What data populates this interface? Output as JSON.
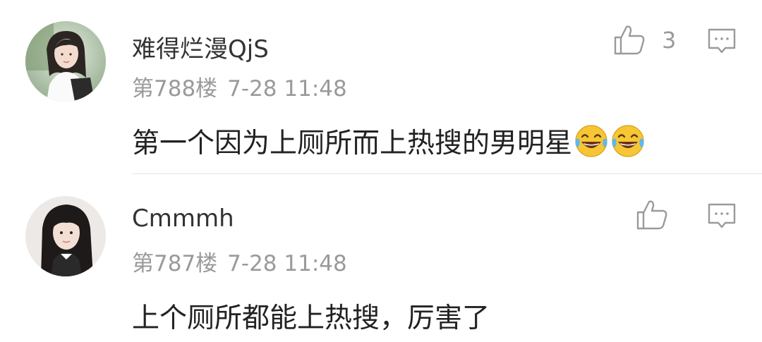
{
  "comments": [
    {
      "username": "难得烂漫QjS",
      "floor": "第788楼",
      "time": "7-28 11:48",
      "text": "第一个因为上厕所而上热搜的男明星",
      "emoji": [
        "laughing-tears-emoji",
        "laughing-tears-emoji"
      ],
      "like_count": "3",
      "avatar": "avatar-girl-1"
    },
    {
      "username": "Cmmmh",
      "floor": "第787楼",
      "time": "7-28 11:48",
      "text": "上个厕所都能上热搜，厉害了",
      "like_count": "",
      "avatar": "avatar-girl-2"
    }
  ],
  "icons": {
    "like": "thumbs-up-icon",
    "reply": "comment-bubble-icon"
  },
  "colors": {
    "username": "#333333",
    "meta": "#9a9a9a",
    "text": "#222222",
    "icon": "#9a9a9a",
    "divider": "#e2e2e2",
    "emoji_face": "#f7c634"
  }
}
